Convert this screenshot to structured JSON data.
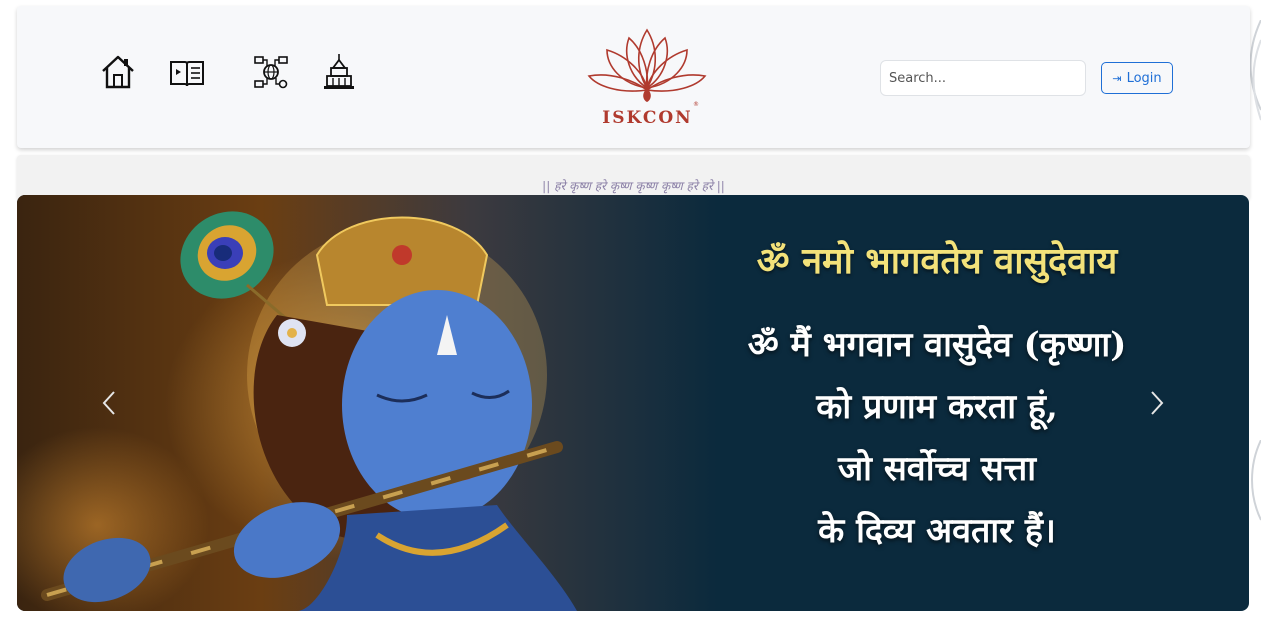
{
  "header": {
    "nav_icons": [
      "home-icon",
      "book-icon",
      "network-globe-icon",
      "temple-icon"
    ],
    "logo_text": "ISKCON",
    "search": {
      "placeholder": "Search...",
      "value": ""
    },
    "login_label": "Login"
  },
  "marquee": {
    "chant": "|| हरे कृष्ण हरे कृष्ण कृष्ण कृष्ण हरे हरे ||"
  },
  "carousel": {
    "mantra": "ॐ नमो भागवतेय वासुदेवाय",
    "meaning_lines": [
      "ॐ मैं भगवान वासुदेव (कृष्णा)",
      "को प्रणाम करता हूं,",
      "जो सर्वोच्च सत्ता",
      "के दिव्य अवतार हैं।"
    ]
  },
  "colors": {
    "brand": "#b03a2e",
    "accent": "#1f6fd6",
    "slide_bg": "#0b2a3d",
    "mantra": "#f3e27a"
  }
}
